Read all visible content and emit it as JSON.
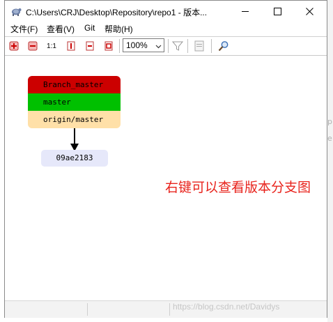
{
  "window": {
    "title": "C:\\Users\\CRJ\\Desktop\\Repository\\repo1 - 版本..."
  },
  "menu": {
    "items": [
      {
        "label": "文件(F)"
      },
      {
        "label": "查看(V)"
      },
      {
        "label": "Git"
      },
      {
        "label": "帮助(H)"
      }
    ]
  },
  "toolbar": {
    "one_to_one_label": "1:1",
    "zoom_value": "100%"
  },
  "graph": {
    "refs": [
      {
        "label": "Branch_master",
        "color": "#cc0000"
      },
      {
        "label": "master",
        "color": "#00c000"
      },
      {
        "label": "origin/master",
        "color": "#ffe0a8"
      }
    ],
    "commit": {
      "label": "09ae2183",
      "color": "#e6e8fa"
    }
  },
  "annotation": {
    "text": "右键可以查看版本分支图",
    "color": "#e8231c"
  },
  "watermark": {
    "text": "https://blog.csdn.net/Davidys"
  },
  "background_fragments": [
    "p",
    "e"
  ]
}
